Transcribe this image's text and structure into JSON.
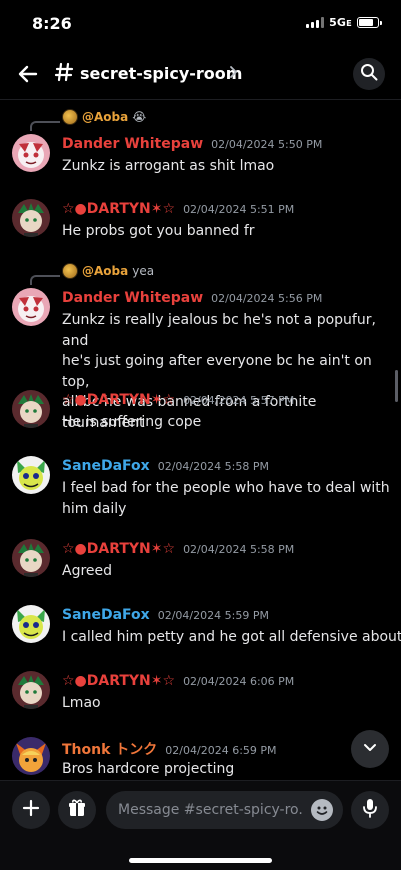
{
  "status": {
    "time": "8:26",
    "network": "5Gᴇ",
    "battery_level": 0.75
  },
  "header": {
    "channel_name": "secret-spicy-room"
  },
  "messages": [
    {
      "reply": {
        "name": "@Aoba",
        "text": "😭"
      },
      "author": "Dander Whitepaw",
      "author_color": "#e8413c",
      "timestamp": "02/04/2024 5:50 PM",
      "lines": [
        "Zunkz is arrogant as shit lmao"
      ]
    },
    {
      "author": "☆●DARTYN✶☆",
      "author_color": "#e8413c",
      "timestamp": "02/04/2024 5:51 PM",
      "lines": [
        "He probs got you banned fr"
      ]
    },
    {
      "reply": {
        "name": "@Aoba",
        "text": "yea"
      },
      "author": "Dander Whitepaw",
      "author_color": "#e8413c",
      "timestamp": "02/04/2024 5:56 PM",
      "lines": [
        "Zunkz is really jealous bc he's not a popufur, and",
        "he's just going after everyone bc he ain't on top,",
        "all bc he was banned from a fortnite tournament"
      ]
    },
    {
      "author": "☆●DARTYN✶☆",
      "author_color": "#e8413c",
      "timestamp": "02/04/2024 5:57 PM",
      "lines": [
        "He is suffering cope"
      ]
    },
    {
      "author": "SaneDaFox",
      "author_color": "#3fa7e8",
      "timestamp": "02/04/2024 5:58 PM",
      "lines": [
        "I feel bad for the people who have to deal with",
        "him daily"
      ]
    },
    {
      "author": "☆●DARTYN✶☆",
      "author_color": "#e8413c",
      "timestamp": "02/04/2024 5:58 PM",
      "lines": [
        "Agreed"
      ]
    },
    {
      "author": "SaneDaFox",
      "author_color": "#3fa7e8",
      "timestamp": "02/04/2024 5:59 PM",
      "lines": [
        "I called him petty and he got all defensive about it"
      ]
    },
    {
      "author": "☆●DARTYN✶☆",
      "author_color": "#e8413c",
      "timestamp": "02/04/2024 6:06 PM",
      "lines": [
        "Lmao"
      ]
    },
    {
      "author": "Thonk トンク",
      "author_color": "#f0763a",
      "timestamp": "02/04/2024 6:59 PM",
      "lines": [
        "Bros hardcore projecting"
      ]
    }
  ],
  "composer": {
    "placeholder": "Message #secret-spicy-ro..."
  },
  "icons": {
    "back": "back-arrow-icon",
    "channel": "hashtag-icon",
    "search": "search-icon",
    "add": "plus-icon",
    "gift": "gift-icon",
    "emoji": "emoji-icon",
    "voice": "microphone-icon",
    "jump": "chevron-down-icon"
  }
}
